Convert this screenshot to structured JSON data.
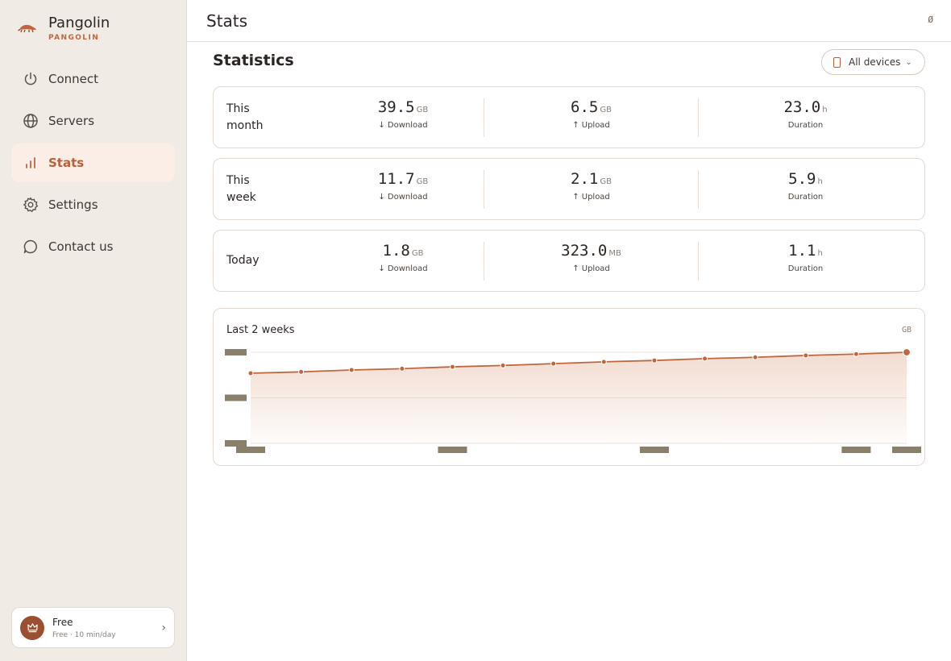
{
  "brand": {
    "name": "Pangolin",
    "sub": "PANGOLIN"
  },
  "nav": [
    {
      "label": "Connect",
      "icon": "power-icon",
      "active": false
    },
    {
      "label": "Servers",
      "icon": "globe-icon",
      "active": false
    },
    {
      "label": "Stats",
      "icon": "bar-chart-icon",
      "active": true
    },
    {
      "label": "Settings",
      "icon": "gear-icon",
      "active": false
    },
    {
      "label": "Contact us",
      "icon": "chat-bubble-icon",
      "active": false
    }
  ],
  "plan": {
    "title": "Free",
    "sub": "Free · 10 min/day"
  },
  "header": {
    "title": "Stats",
    "glyph": "Ø"
  },
  "section": {
    "title": "Statistics"
  },
  "device_select": {
    "label": "All devices"
  },
  "stats": [
    {
      "label": "This month",
      "download": {
        "value": "39.5",
        "unit": "GB",
        "caption": "↓ Download"
      },
      "upload": {
        "value": "6.5",
        "unit": "GB",
        "caption": "↑ Upload"
      },
      "duration": {
        "value": "23.0",
        "unit": "h",
        "caption": "Duration"
      }
    },
    {
      "label": "This week",
      "download": {
        "value": "11.7",
        "unit": "GB",
        "caption": "↓ Download"
      },
      "upload": {
        "value": "2.1",
        "unit": "GB",
        "caption": "↑ Upload"
      },
      "duration": {
        "value": "5.9",
        "unit": "h",
        "caption": "Duration"
      }
    },
    {
      "label": "Today",
      "download": {
        "value": "1.8",
        "unit": "GB",
        "caption": "↓ Download"
      },
      "upload": {
        "value": "323.0",
        "unit": "MB",
        "caption": "↑ Upload"
      },
      "duration": {
        "value": "1.1",
        "unit": "h",
        "caption": "Duration"
      }
    }
  ],
  "chart": {
    "title": "Last 2 weeks",
    "unit": "GB"
  },
  "chart_data": {
    "type": "area",
    "title": "Last 2 weeks",
    "ylabel": "GB",
    "x": [
      1,
      2,
      3,
      4,
      5,
      6,
      7,
      8,
      9,
      10,
      11,
      12,
      13,
      14
    ],
    "series": [
      {
        "values": [
          1.54,
          1.57,
          1.61,
          1.64,
          1.68,
          1.71,
          1.75,
          1.79,
          1.82,
          1.86,
          1.89,
          1.93,
          1.96,
          2.0
        ]
      }
    ],
    "ylim": [
      0,
      2.0
    ],
    "grid": true,
    "colors": {
      "line": "#c0663e",
      "fill": "#e7bfa9"
    }
  },
  "colors": {
    "accent": "#c0663e",
    "sidebar_bg": "#f1ebe5",
    "active_bg": "#faeee7",
    "plan_badge": "#9b4f30"
  }
}
